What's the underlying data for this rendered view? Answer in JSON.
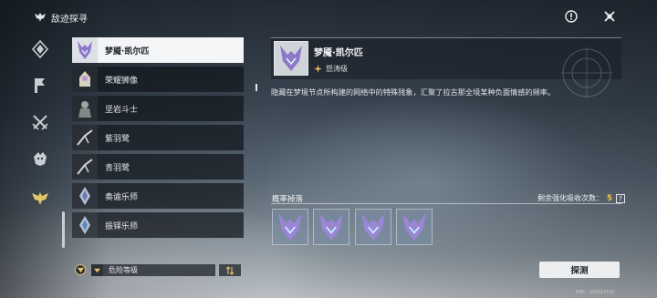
{
  "app": {
    "title": "敌迹探寻",
    "uid": "PID: 101527110"
  },
  "colors": {
    "accent": "#f3c452",
    "selected_bg": "#f4f5f6",
    "item_bg": "#12161c"
  },
  "nav": {
    "items": [
      {
        "icon": "diamond-crest-icon"
      },
      {
        "icon": "banner-flag-icon"
      },
      {
        "icon": "crossed-swords-icon"
      },
      {
        "icon": "beast-head-icon"
      },
      {
        "icon": "winged-demon-icon",
        "active": true
      }
    ]
  },
  "list": {
    "items": [
      {
        "name": "梦魇·凯尔匹",
        "icon": "kelpie-portrait-icon",
        "selected": true
      },
      {
        "name": "荣耀狮像",
        "icon": "lion-statue-icon"
      },
      {
        "name": "坚岩斗士",
        "icon": "rock-fighter-icon"
      },
      {
        "name": "紫羽鹭",
        "icon": "purple-heron-icon"
      },
      {
        "name": "青羽鹭",
        "icon": "cyan-heron-icon"
      },
      {
        "name": "奏谕乐师",
        "icon": "oracle-musician-icon"
      },
      {
        "name": "振铎乐师",
        "icon": "bell-musician-icon"
      }
    ]
  },
  "detail": {
    "name": "梦魇·凯尔匹",
    "rank": "怒涛级",
    "description": "隐藏在梦境节点所构建的网络中的特殊残象，汇聚了拉古那全境某种负面情感的频率。"
  },
  "drops": {
    "title": "概率掉落",
    "remaining_label": "剩余强化吸收次数：",
    "remaining_count": "5",
    "help": "?",
    "slots": 4
  },
  "controls": {
    "sort_label": "危险等级",
    "explore_label": "探测"
  }
}
